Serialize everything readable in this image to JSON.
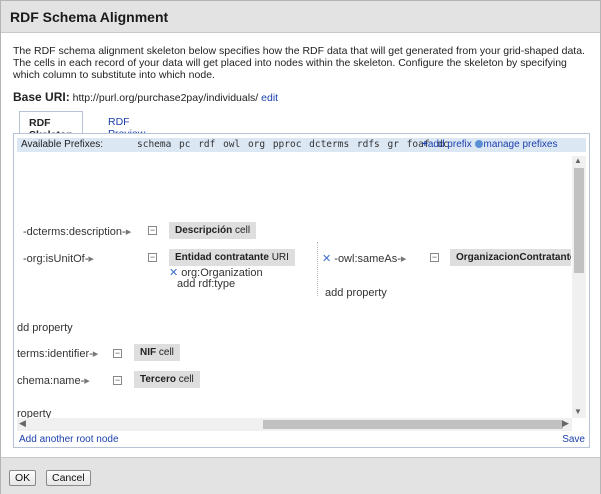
{
  "dialog": {
    "title": "RDF Schema Alignment",
    "description": "The RDF schema alignment skeleton below specifies how the RDF data that will get generated from your grid-shaped data. The cells in each record of your data will get placed into nodes within the skeleton. Configure the skeleton by specifying which column to substitute into which node.",
    "base_uri_label": "Base URI:",
    "base_uri_value": "http://purl.org/purchase2pay/individuals/",
    "base_uri_edit": "edit"
  },
  "tabs": [
    {
      "label": "RDF Skeleton",
      "active": true
    },
    {
      "label": "RDF Preview",
      "active": false
    }
  ],
  "prefixes": {
    "label": "Available Prefixes:",
    "list": "schema pc rdf owl org pproc dcterms rdfs gr foaf dc",
    "add_prefix": "add prefix",
    "manage_prefixes": "manage prefixes"
  },
  "skeleton": {
    "row1": {
      "property": "-dcterms:description-",
      "cell": "Descripción",
      "cell_suffix": "cell"
    },
    "row2": {
      "property": "-org:isUnitOf-",
      "cell": "Entidad contratante",
      "cell_suffix": "URI",
      "type": "org:Organization",
      "add_type": "add rdf:type",
      "sub_property": "-owl:sameAs-",
      "sub_cell": "OrganizacionContratante",
      "add_property": "add property"
    },
    "add_property_1": "dd property",
    "row3": {
      "property": "terms:identifier-",
      "cell": "NIF",
      "cell_suffix": "cell"
    },
    "row4": {
      "property": "chema:name-",
      "cell": "Tercero",
      "cell_suffix": "cell"
    },
    "add_property_2": "roperty"
  },
  "panel_footer": {
    "add_root": "Add another root node",
    "save": "Save"
  },
  "buttons": {
    "ok": "OK",
    "cancel": "Cancel"
  }
}
